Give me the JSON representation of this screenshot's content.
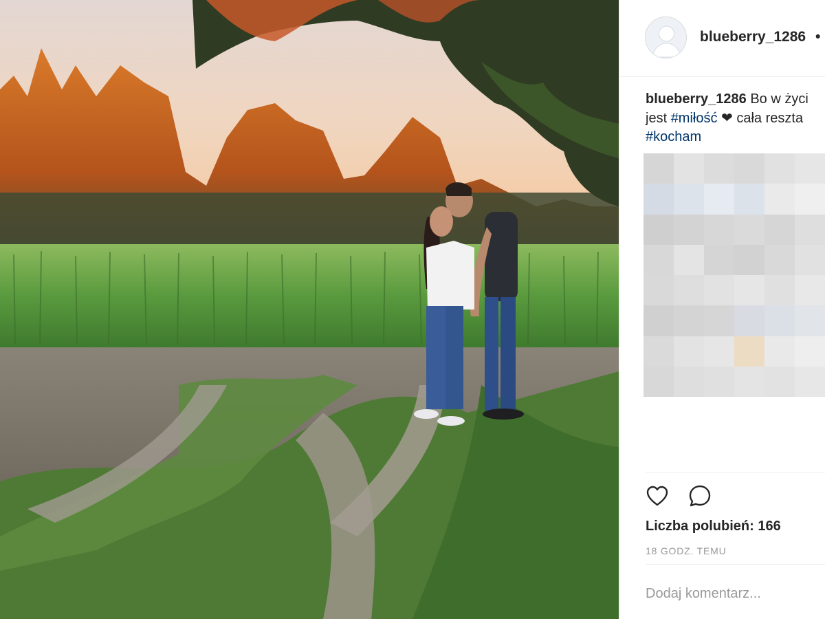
{
  "post": {
    "username": "blueberry_1286",
    "header_separator": "•",
    "caption": {
      "username": "blueberry_1286",
      "text_line1": " Bo w życi",
      "text_line2_prefix": "jest ",
      "hashtag1": "#miłość",
      "heart": "❤",
      "text_line2_suffix": " cała reszta",
      "hashtag2": "#kocham"
    },
    "likes_text": "Liczba polubień: 166",
    "timestamp": "18 GODZ. TEMU",
    "comment_placeholder": "Dodaj komentarz..."
  },
  "icons": {
    "like": "heart-outline-icon",
    "comment": "speech-bubble-icon",
    "avatar": "default-user-avatar"
  },
  "colors": {
    "hashtag": "#003569",
    "text": "#262626",
    "muted": "#999999",
    "divider": "#efefef"
  },
  "mosaic_colors": [
    "#d6d6d6",
    "#e3e3e3",
    "#dcdcdc",
    "#d9d9d9",
    "#e1e1e1",
    "#e6e6e6",
    "#d5dbe4",
    "#dde3ea",
    "#e6ebf1",
    "#dbe2ea",
    "#eaeaea",
    "#efefef",
    "#cfcfcf",
    "#d3d3d3",
    "#d7d7d7",
    "#dadada",
    "#d6d6d6",
    "#dedede",
    "#d8d8d8",
    "#e4e4e4",
    "#d5d5d5",
    "#d2d2d2",
    "#d9d9d9",
    "#e1e1e1",
    "#d9d9d9",
    "#dedede",
    "#e2e2e2",
    "#e6e6e6",
    "#e0e0e0",
    "#e8e8e8",
    "#d0d0d0",
    "#d4d4d4",
    "#d6d6d6",
    "#d8dce2",
    "#dbe0e6",
    "#e1e4e8",
    "#dadada",
    "#e3e3e3",
    "#e6e6e6",
    "#ecdcc4",
    "#e9e9e9",
    "#eeeeee",
    "#d8d8d8",
    "#dedede",
    "#e0e0e0",
    "#e4e4e4",
    "#e2e2e2",
    "#e7e7e7"
  ]
}
